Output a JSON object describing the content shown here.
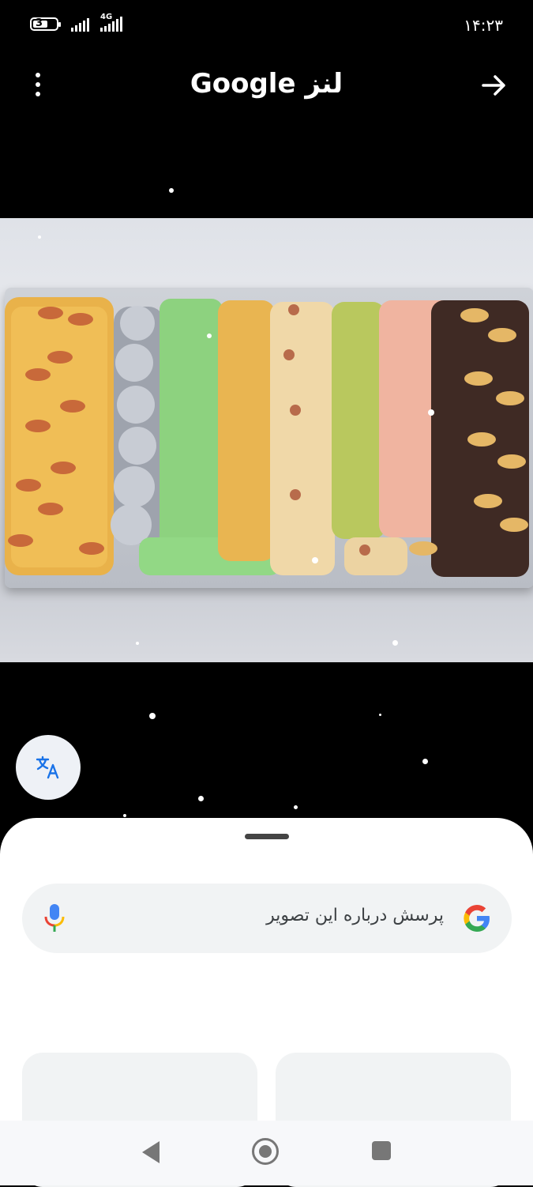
{
  "status_bar": {
    "battery_level": "3",
    "network": "4G",
    "time": "۱۴:۲۳"
  },
  "app_bar": {
    "title": "Google لنز"
  },
  "photo": {
    "description_icon": "cookies-tray-image"
  },
  "search": {
    "placeholder": "پرسش درباره این تصویر"
  },
  "colors": {
    "background": "#000000",
    "sheet": "#ffffff",
    "search_bg": "#f1f3f4",
    "translate_icon": "#1a73e8"
  }
}
